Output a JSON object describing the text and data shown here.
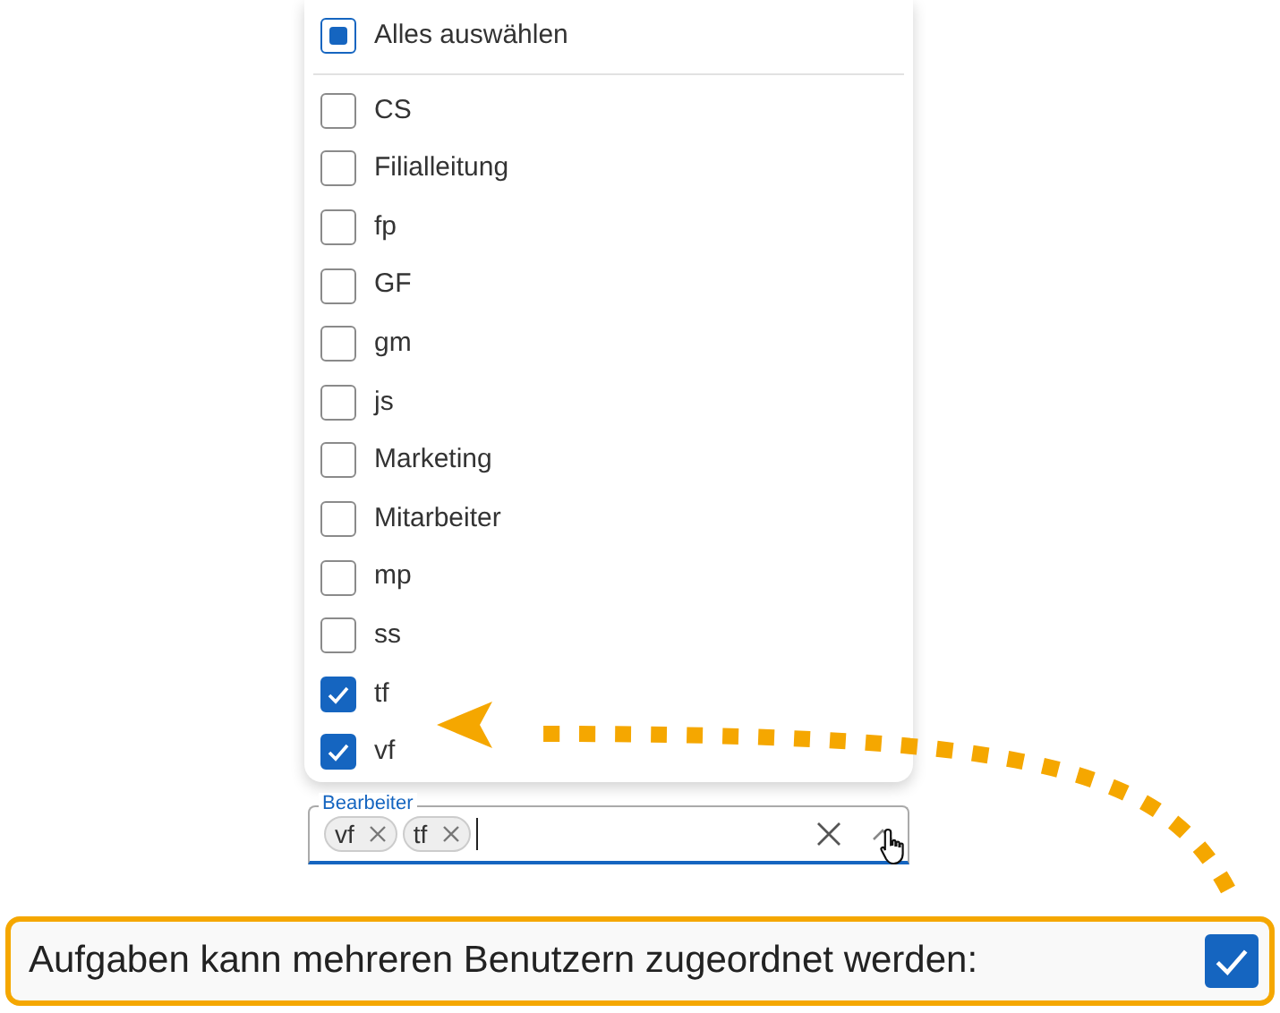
{
  "dropdown": {
    "select_all": {
      "label": "Alles auswählen",
      "indeterminate": true
    },
    "options": [
      {
        "label": "CS",
        "checked": false
      },
      {
        "label": "Filialleitung",
        "checked": false
      },
      {
        "label": "fp",
        "checked": false
      },
      {
        "label": "GF",
        "checked": false
      },
      {
        "label": "gm",
        "checked": false
      },
      {
        "label": "js",
        "checked": false
      },
      {
        "label": "Marketing",
        "checked": false
      },
      {
        "label": "Mitarbeiter",
        "checked": false
      },
      {
        "label": "mp",
        "checked": false
      },
      {
        "label": "ss",
        "checked": false
      },
      {
        "label": "tf",
        "checked": true
      },
      {
        "label": "vf",
        "checked": true
      }
    ]
  },
  "field": {
    "label": "Bearbeiter",
    "chips": [
      "vf",
      "tf"
    ]
  },
  "setting": {
    "label": "Aufgaben kann mehreren Benutzern zugeordnet werden:",
    "checked": true
  }
}
